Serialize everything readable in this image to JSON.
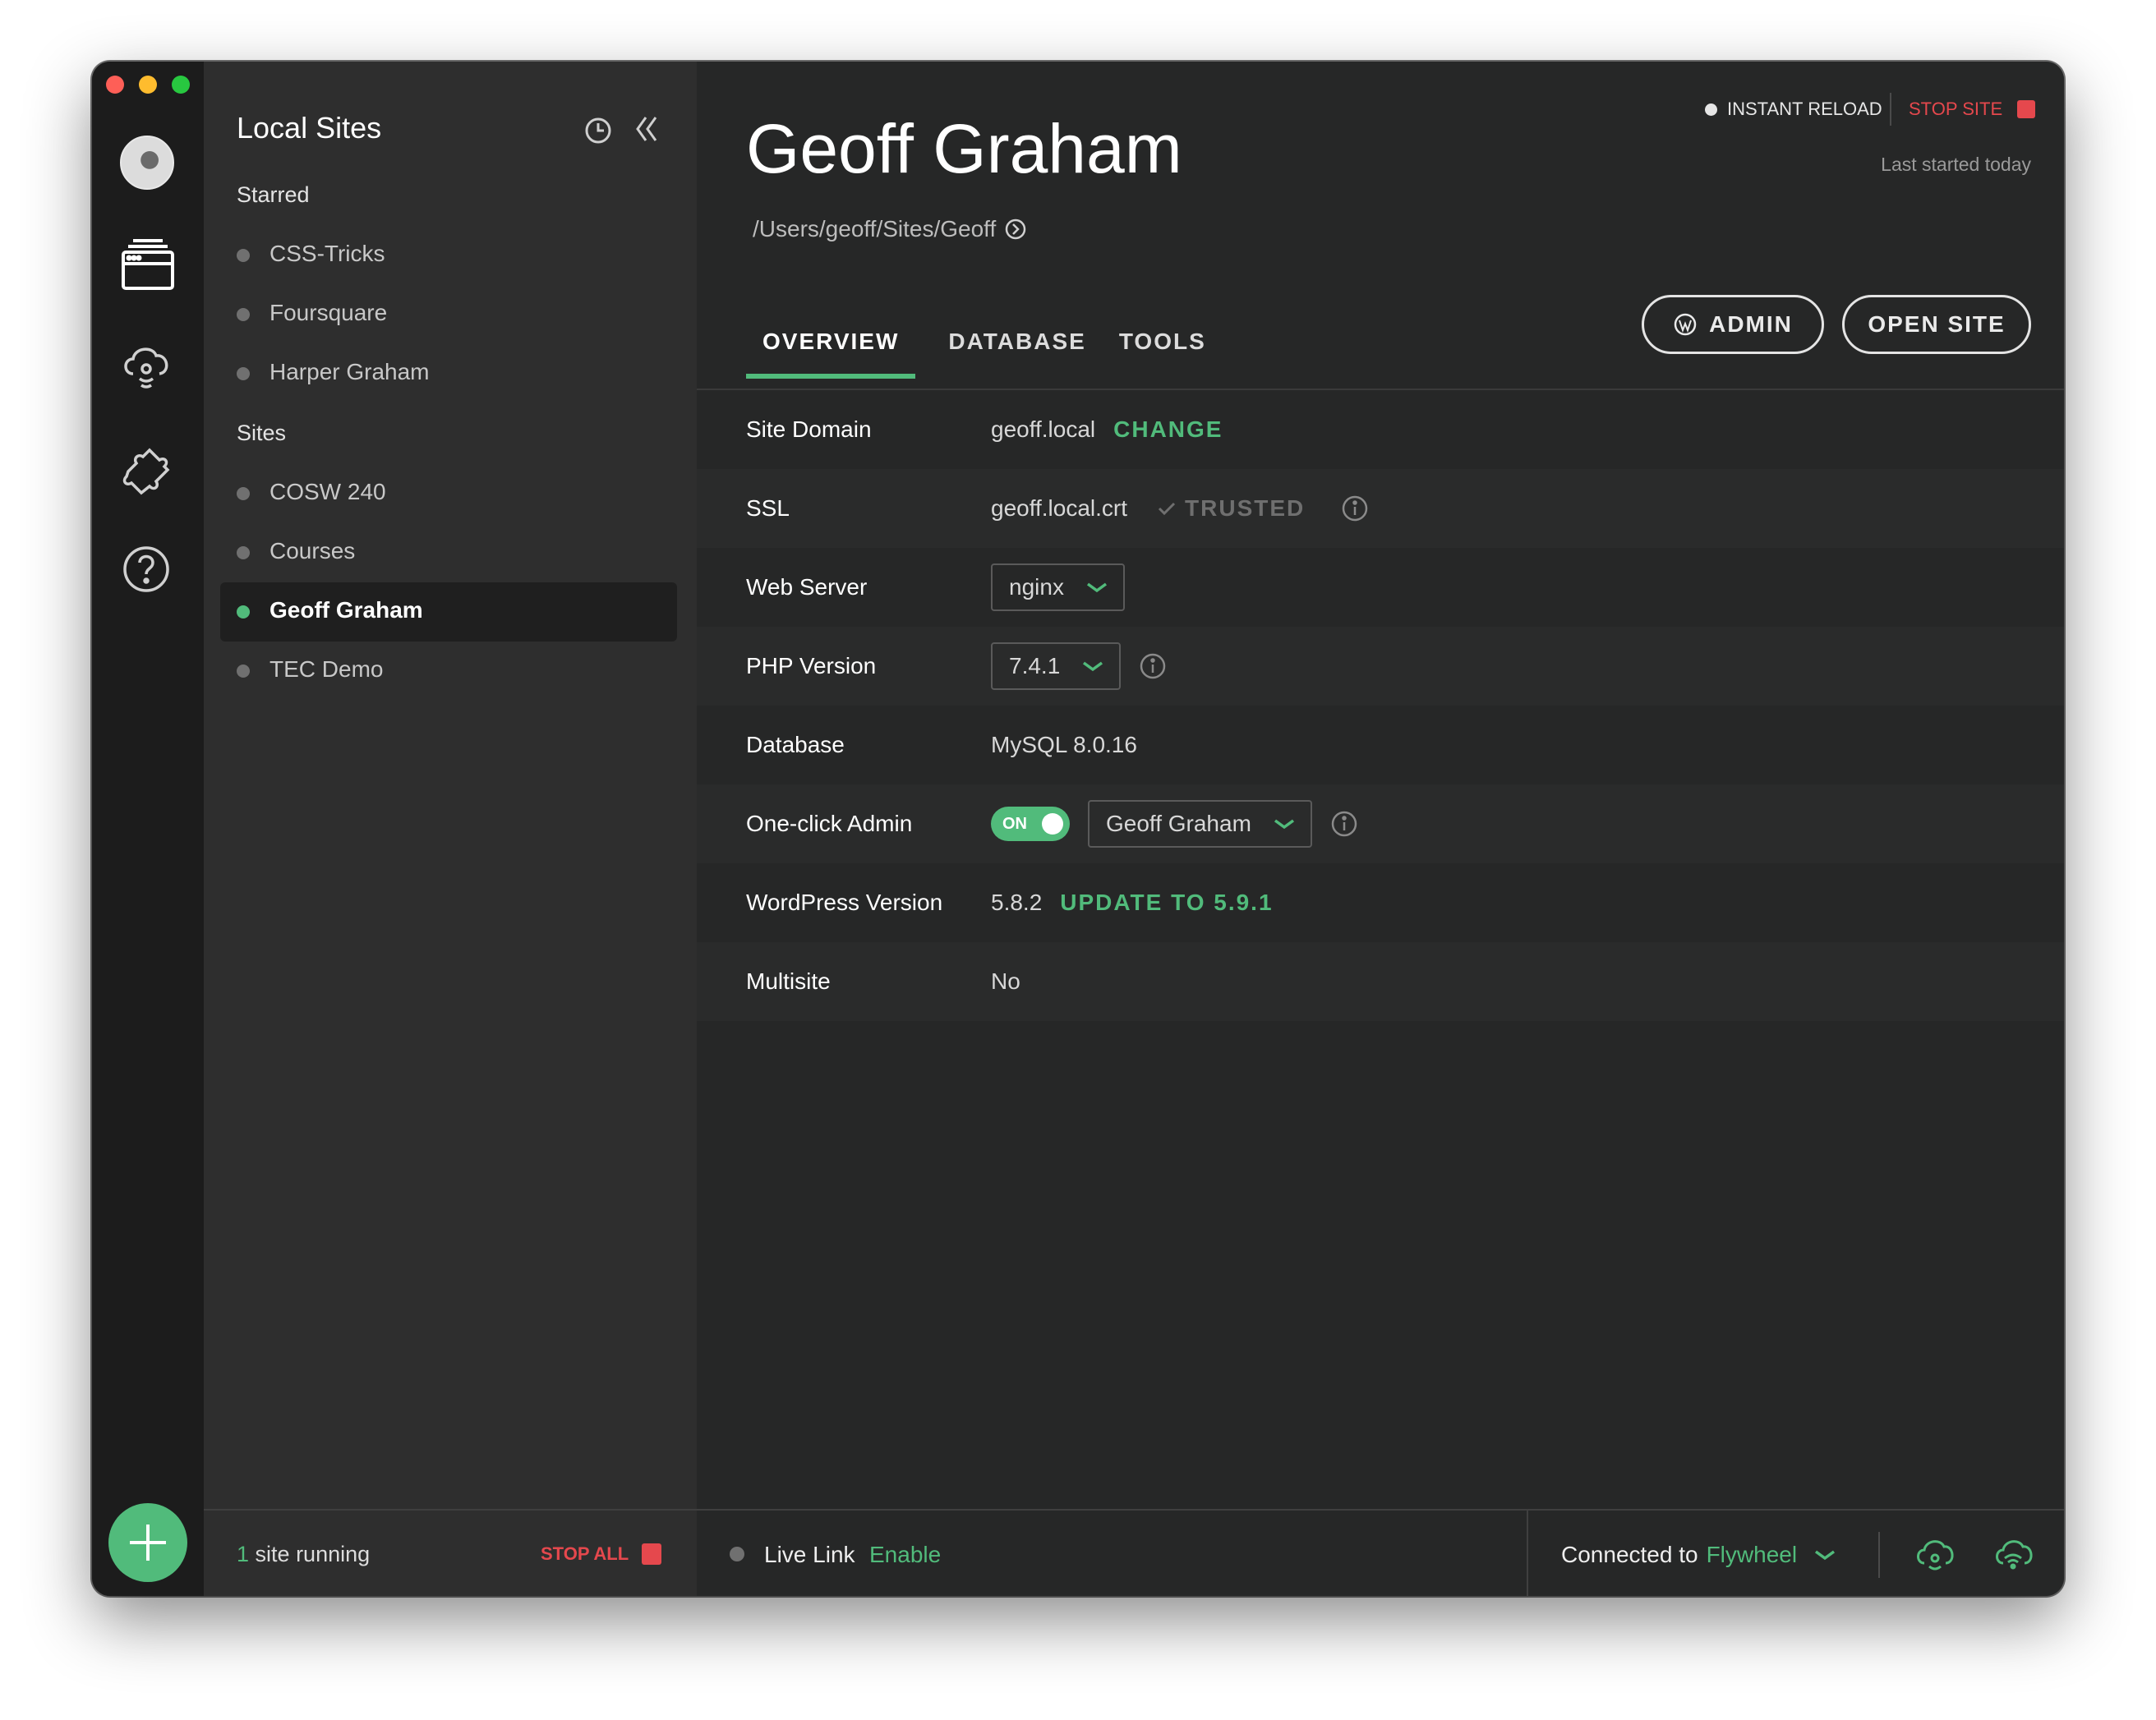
{
  "sidebar": {
    "title": "Local Sites",
    "starred_heading": "Starred",
    "starred": [
      {
        "label": "CSS-Tricks"
      },
      {
        "label": "Foursquare"
      },
      {
        "label": "Harper Graham"
      }
    ],
    "sites_heading": "Sites",
    "sites": [
      {
        "label": "COSW 240"
      },
      {
        "label": "Courses"
      },
      {
        "label": "Geoff Graham",
        "active": true
      },
      {
        "label": "TEC Demo"
      }
    ]
  },
  "header": {
    "site_name": "Geoff Graham",
    "path": "/Users/geoff/Sites/Geoff",
    "instant_reload": "INSTANT RELOAD",
    "stop_site": "STOP SITE",
    "last_started": "Last started today",
    "admin_button": "ADMIN",
    "open_site_button": "OPEN SITE"
  },
  "tabs": [
    {
      "label": "OVERVIEW",
      "active": true
    },
    {
      "label": "DATABASE"
    },
    {
      "label": "TOOLS"
    }
  ],
  "overview": {
    "site_domain": {
      "label": "Site Domain",
      "value": "geoff.local",
      "action": "CHANGE"
    },
    "ssl": {
      "label": "SSL",
      "value": "geoff.local.crt",
      "status": "TRUSTED"
    },
    "web_server": {
      "label": "Web Server",
      "value": "nginx"
    },
    "php_version": {
      "label": "PHP Version",
      "value": "7.4.1"
    },
    "database": {
      "label": "Database",
      "value": "MySQL 8.0.16"
    },
    "one_click_admin": {
      "label": "One-click Admin",
      "toggle": "ON",
      "user": "Geoff Graham"
    },
    "wordpress_version": {
      "label": "WordPress Version",
      "value": "5.8.2",
      "action": "UPDATE TO 5.9.1"
    },
    "multisite": {
      "label": "Multisite",
      "value": "No"
    }
  },
  "footer": {
    "running_count": "1",
    "running_text": "site running",
    "stop_all": "STOP ALL",
    "live_link_label": "Live Link",
    "live_link_action": "Enable",
    "connected_prefix": "Connected to",
    "connected_service": "Flywheel"
  },
  "colors": {
    "accent_green": "#51bb7b",
    "stop_red": "#e5484d",
    "background": "#262727",
    "sidebar": "#2e2e2e",
    "rail": "#1c1c1c"
  },
  "icons": [
    "avatar",
    "sites-icon",
    "cloud-icon",
    "addons-icon",
    "help-icon",
    "add-icon",
    "history-icon",
    "collapse-icon",
    "wordpress-icon",
    "info-icon",
    "chevron-down-icon",
    "cloud-sync-icon",
    "cloud-wifi-icon"
  ]
}
